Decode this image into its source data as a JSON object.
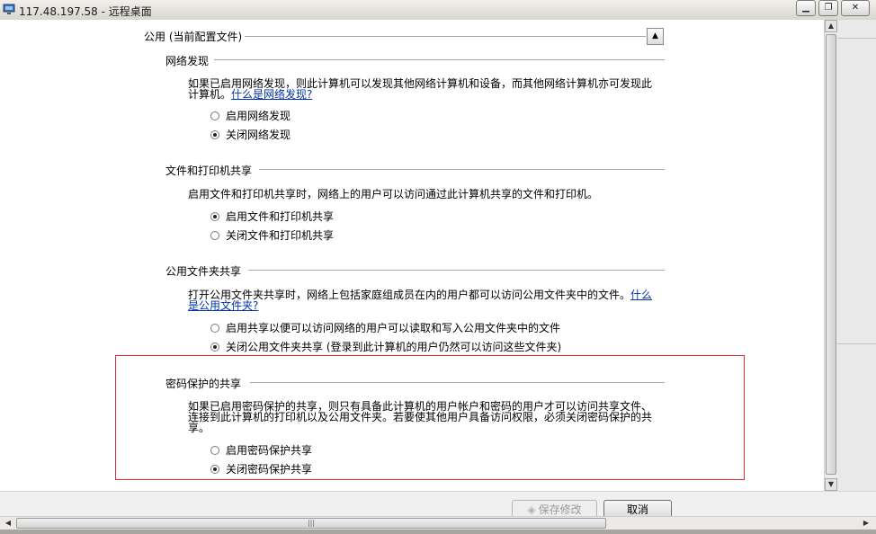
{
  "window": {
    "title": "117.48.197.58 - 远程桌面",
    "minimize_glyph": "▁",
    "restore_glyph": "❐",
    "close_glyph": "✕"
  },
  "public_profile": {
    "header": "公用 (当前配置文件)",
    "collapse_glyph": "▲",
    "sections": {
      "network_discovery": {
        "title": "网络发现",
        "desc_line1": "如果已启用网络发现，则此计算机可以发现其他网络计算机和设备，而其他网络计算机亦可发现此",
        "desc_line2": "计算机。",
        "link": "什么是网络发现?",
        "option_on": "启用网络发现",
        "option_off": "关闭网络发现",
        "selected": "off"
      },
      "file_printer_sharing": {
        "title": "文件和打印机共享",
        "desc": "启用文件和打印机共享时，网络上的用户可以访问通过此计算机共享的文件和打印机。",
        "option_on": "启用文件和打印机共享",
        "option_off": "关闭文件和打印机共享",
        "selected": "on"
      },
      "public_folder_sharing": {
        "title": "公用文件夹共享",
        "desc_line1": "打开公用文件夹共享时，网络上包括家庭组成员在内的用户都可以访问公用文件夹中的文件。",
        "link_part1": "什么",
        "link_part2": "是公用文件夹?",
        "option_on": "启用共享以便可以访问网络的用户可以读取和写入公用文件夹中的文件",
        "option_off": "关闭公用文件夹共享 (登录到此计算机的用户仍然可以访问这些文件夹)",
        "selected": "off"
      },
      "password_protected_sharing": {
        "title": "密码保护的共享",
        "desc_line1": "如果已启用密码保护的共享，则只有具备此计算机的用户帐户和密码的用户才可以访问共享文件、",
        "desc_line2": "连接到此计算机的打印机以及公用文件夹。若要使其他用户具备访问权限，必须关闭密码保护的共",
        "desc_line3": "享。",
        "option_on": "启用密码保护共享",
        "option_off": "关闭密码保护共享",
        "selected": "off"
      }
    }
  },
  "footer": {
    "save_label": "保存修改",
    "cancel_label": "取消"
  },
  "scrollbars": {
    "up_glyph": "▲",
    "down_glyph": "▼",
    "left_glyph": "◀",
    "right_glyph": "▶",
    "grip_glyph": "|||"
  },
  "colors": {
    "highlight_border": "#d93030",
    "link": "#0033aa"
  }
}
